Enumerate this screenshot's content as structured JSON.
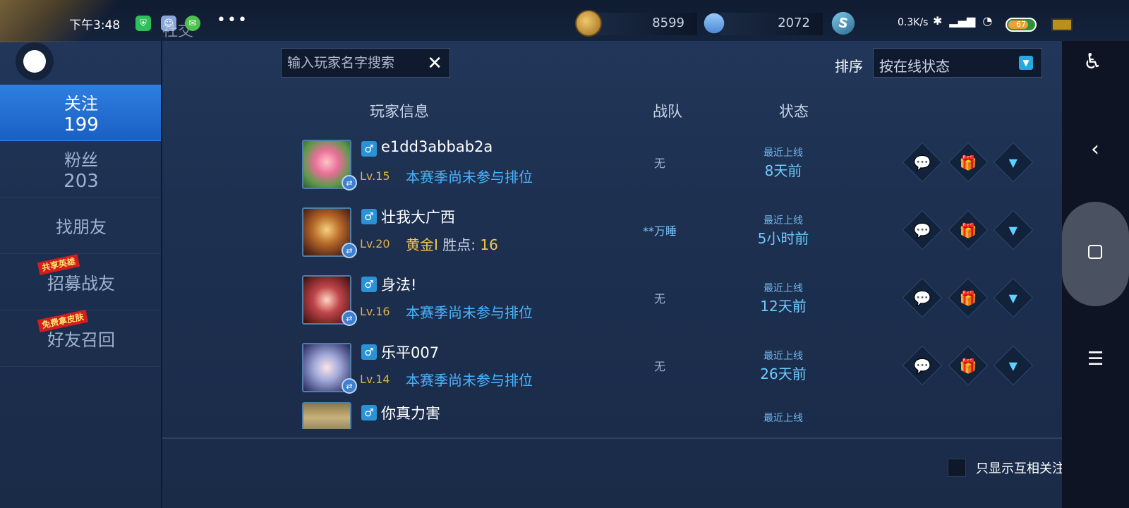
{
  "statusbar": {
    "time": "下午3:48",
    "game_title": "社交",
    "more": "•••",
    "gold": "8599",
    "diamond": "2072",
    "net_speed": "0.3K/s"
  },
  "search": {
    "placeholder": "输入玩家名字搜索"
  },
  "sort": {
    "label": "排序",
    "value": "按在线状态"
  },
  "sidebar": {
    "items": [
      {
        "label": "关注",
        "count": "199"
      },
      {
        "label": "粉丝",
        "count": "203"
      },
      {
        "label": "找朋友"
      },
      {
        "label": "招募战友",
        "badge": "共享英雄"
      },
      {
        "label": "好友召回",
        "badge": "免费拿皮肤"
      }
    ]
  },
  "columns": {
    "player": "玩家信息",
    "team": "战队",
    "status": "状态"
  },
  "players": [
    {
      "gender": "♂",
      "name": "e1dd3abbab2a",
      "level": "Lv.15",
      "rank": "本赛季尚未参与排位",
      "team": "无",
      "status_label": "最近上线",
      "status_time": "8天前"
    },
    {
      "gender": "♂",
      "name": "壮我大广西",
      "level": "Lv.20",
      "rank_tier": "黄金I",
      "rank_pts_label": "胜点:",
      "rank_pts": "16",
      "team": "**万睡",
      "status_label": "最近上线",
      "status_time": "5小时前"
    },
    {
      "gender": "♂",
      "name": "身法!",
      "level": "Lv.16",
      "rank": "本赛季尚未参与排位",
      "team": "无",
      "status_label": "最近上线",
      "status_time": "12天前"
    },
    {
      "gender": "♂",
      "name": "乐平007",
      "level": "Lv.14",
      "rank": "本赛季尚未参与排位",
      "team": "无",
      "status_label": "最近上线",
      "status_time": "26天前"
    },
    {
      "gender": "♂",
      "name": "你真力害",
      "status_label": "最近上线"
    }
  ],
  "footer": {
    "mutual_only": "只显示互相关注"
  },
  "colors": {
    "accent": "#2d7fe0",
    "link": "#49b4ff",
    "gold": "#f2c94c"
  }
}
